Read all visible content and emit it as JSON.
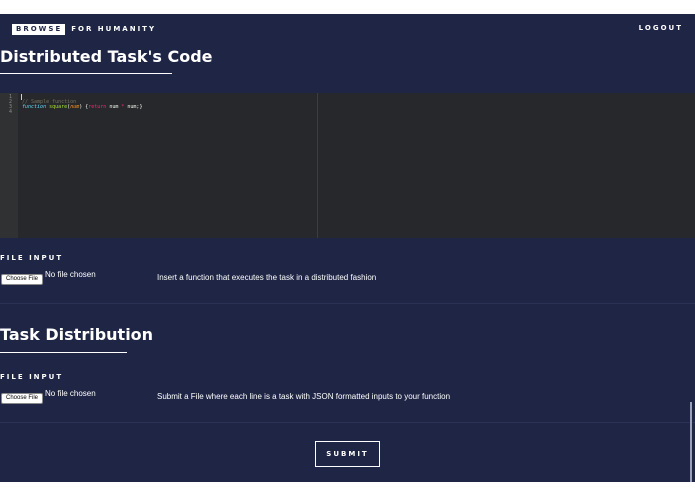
{
  "header": {
    "brand_box": "BROWSE",
    "brand_rest": "FOR HUMANITY",
    "logout": "LOGOUT"
  },
  "code_section": {
    "title": "Distributed Task's Code",
    "line_numbers": [
      "1",
      "2",
      "3",
      "4"
    ],
    "code": {
      "comment": "// Sample function",
      "kw_function": "function",
      "fn_name": "square",
      "paren_open": "(",
      "param": "num",
      "paren_close_brace": ") {",
      "kw_return": "return",
      "expr_a": " num ",
      "op_mul": "*",
      "expr_b": " num;}"
    }
  },
  "file_input_1": {
    "label": "FILE INPUT",
    "button": "Choose File",
    "status": "No file chosen",
    "hint": "Insert a function that executes the task in a distributed fashion"
  },
  "distribution_section": {
    "title": "Task Distribution"
  },
  "file_input_2": {
    "label": "FILE INPUT",
    "button": "Choose File",
    "status": "No file chosen",
    "hint": "Submit a File where each line is a task with JSON formatted inputs to your function"
  },
  "submit_label": "SUBMIT",
  "colors": {
    "page_background": "#1f2545",
    "editor_background": "#27282b",
    "accent_white": "#ffffff"
  }
}
